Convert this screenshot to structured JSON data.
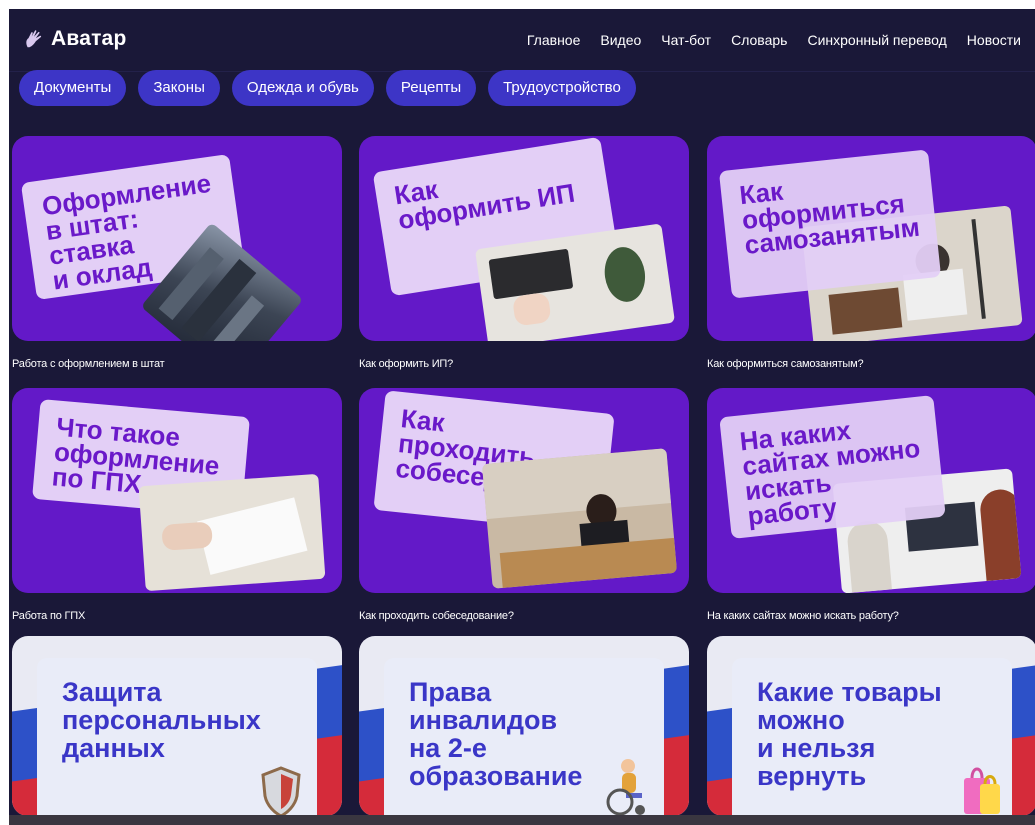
{
  "header": {
    "logo_text": "Аватар",
    "logo_icon": "hand-icon",
    "nav": [
      "Главное",
      "Видео",
      "Чат-бот",
      "Словарь",
      "Синхронный перевод",
      "Новости"
    ]
  },
  "categories": [
    "Документы",
    "Законы",
    "Одежда и обувь",
    "Рецепты",
    "Трудоустройство"
  ],
  "cards": [
    {
      "title": "Оформление\nв штат: ставка\nи оклад",
      "caption": "Работа с оформлением в штат"
    },
    {
      "title": "Как\nоформить ИП",
      "caption": "Как оформить ИП?"
    },
    {
      "title": "Как\nоформиться\nсамозанятым",
      "caption": "Как оформиться самозанятым?"
    },
    {
      "title": "Что такое\nоформление\nпо ГПХ",
      "caption": "Работа по ГПХ"
    },
    {
      "title": "Как\nпроходить\nсобеседование",
      "caption": "Как проходить собеседование?"
    },
    {
      "title": "На каких\nсайтах можно\nискать работу",
      "caption": "На каких сайтах можно искать работу?"
    }
  ],
  "flag_cards": [
    {
      "title": "Защита\nперсональных\nданных",
      "sticker": "shield-icon"
    },
    {
      "title": "Права\nинвалидов\nна 2-е\nобразование",
      "sticker": "wheelchair-icon"
    },
    {
      "title": "Какие товары\nможно\nи нельзя\nвернуть",
      "sticker": "shopping-bag-icon"
    }
  ],
  "colors": {
    "background": "#1a1838",
    "chip": "#3d35c6",
    "card_purple": "#6319c8",
    "card_paper": "#e3cff6",
    "card_title": "#6a19c9",
    "flag_blue": "#2d51c8",
    "flag_red": "#d52b3a",
    "flag_title": "#3a36c7"
  }
}
